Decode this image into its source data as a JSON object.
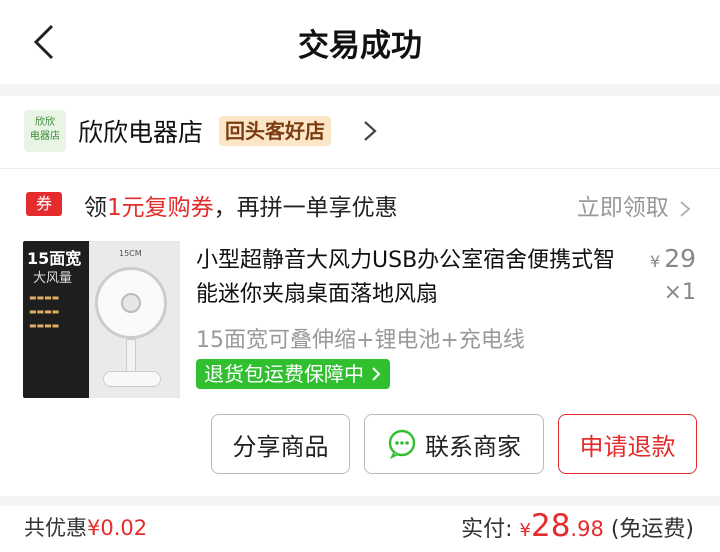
{
  "header": {
    "title": "交易成功"
  },
  "store": {
    "logo_line1": "欣欣",
    "logo_line2": "电器店",
    "name": "欣欣电器店",
    "badge": "回头客好店"
  },
  "coupon": {
    "tag": "券",
    "prefix": "领",
    "highlight": "1元复购券",
    "suffix": "，再拼一单享优惠",
    "action": "立即领取"
  },
  "product": {
    "image_text": {
      "title": "15面宽",
      "subtitle": "大风量",
      "size": "15CM"
    },
    "title": "小型超静音大风力USB办公室宿舍便携式智能迷你夹扇桌面落地风扇",
    "price_symbol": "¥",
    "price": "29",
    "quantity": "×1",
    "spec": "15面宽可叠伸缩+锂电池+充电线",
    "guarantee": "退货包运费保障中"
  },
  "actions": {
    "share": "分享商品",
    "contact": "联系商家",
    "refund": "申请退款"
  },
  "footer": {
    "savings_label": "共优惠",
    "savings_amount": "¥0.02",
    "paid_label": "实付:",
    "paid_symbol": "¥",
    "paid_int": "28",
    "paid_dec": ".98",
    "shipping": "(免运费)"
  },
  "colors": {
    "accent": "#e52b2b",
    "guarantee": "#2fbf2f",
    "muted": "#999999"
  },
  "icons": [
    "back-arrow-icon",
    "chevron-right-icon",
    "chat-bubble-icon"
  ]
}
